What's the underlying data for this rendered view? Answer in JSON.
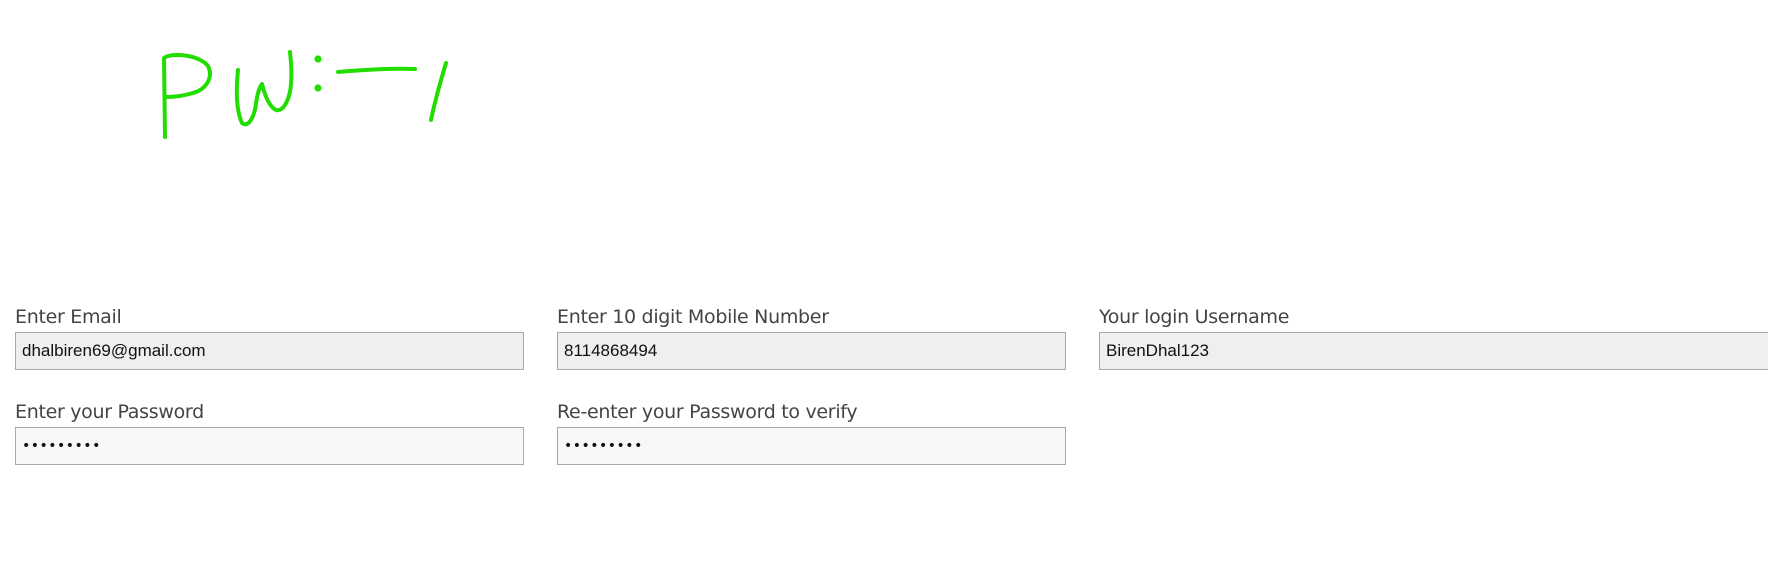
{
  "annotation": {
    "text": "PW:—/",
    "color": "#22dd00"
  },
  "form": {
    "email": {
      "label": "Enter Email",
      "value": "dhalbiren69@gmail.com"
    },
    "mobile": {
      "label": "Enter 10 digit Mobile Number",
      "value": "8114868494"
    },
    "username": {
      "label": "Your login Username",
      "value": "BirenDhal123"
    },
    "password": {
      "label": "Enter your Password",
      "value": "123456789"
    },
    "password_confirm": {
      "label": "Re-enter your Password to verify",
      "value": "123456789"
    }
  }
}
